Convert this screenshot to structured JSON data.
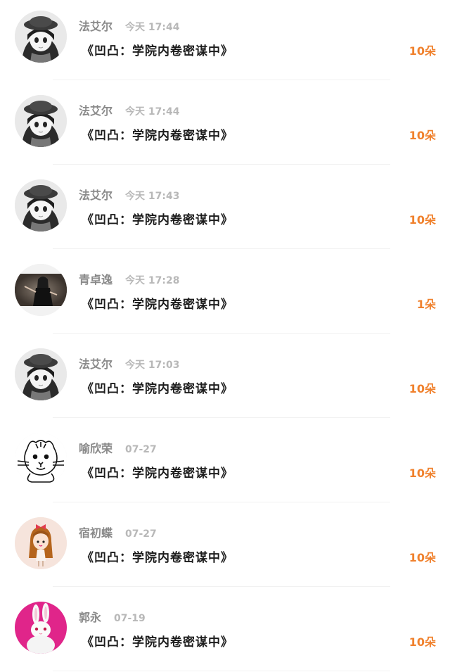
{
  "records": [
    {
      "name": "法艾尔",
      "time": "今天 17:44",
      "gift": "《凹凸：学院内卷密谋中》",
      "count": "10朵",
      "avatar": "anime-girl-hat"
    },
    {
      "name": "法艾尔",
      "time": "今天 17:44",
      "gift": "《凹凸：学院内卷密谋中》",
      "count": "10朵",
      "avatar": "anime-girl-hat"
    },
    {
      "name": "法艾尔",
      "time": "今天 17:43",
      "gift": "《凹凸：学院内卷密谋中》",
      "count": "10朵",
      "avatar": "anime-girl-hat"
    },
    {
      "name": "青卓逸",
      "time": "今天 17:28",
      "gift": "《凹凸：学院内卷密谋中》",
      "count": "1朵",
      "avatar": "photo-girl-dark"
    },
    {
      "name": "法艾尔",
      "time": "今天 17:03",
      "gift": "《凹凸：学院内卷密谋中》",
      "count": "10朵",
      "avatar": "anime-girl-hat"
    },
    {
      "name": "喻欣荣",
      "time": "07-27",
      "gift": "《凹凸：学院内卷密谋中》",
      "count": "10朵",
      "avatar": "tiger-sketch"
    },
    {
      "name": "宿初蝶",
      "time": "07-27",
      "gift": "《凹凸：学院内卷密谋中》",
      "count": "10朵",
      "avatar": "cartoon-girl-bow"
    },
    {
      "name": "郭永",
      "time": "07-19",
      "gift": "《凹凸：学院内卷密谋中》",
      "count": "10朵",
      "avatar": "white-rabbit"
    }
  ],
  "colors": {
    "name": "#8a8a8a",
    "time": "#b8b8b8",
    "gift": "#1c1c1c",
    "count_accent": "#f0812d",
    "divider": "#f1f1f1"
  }
}
